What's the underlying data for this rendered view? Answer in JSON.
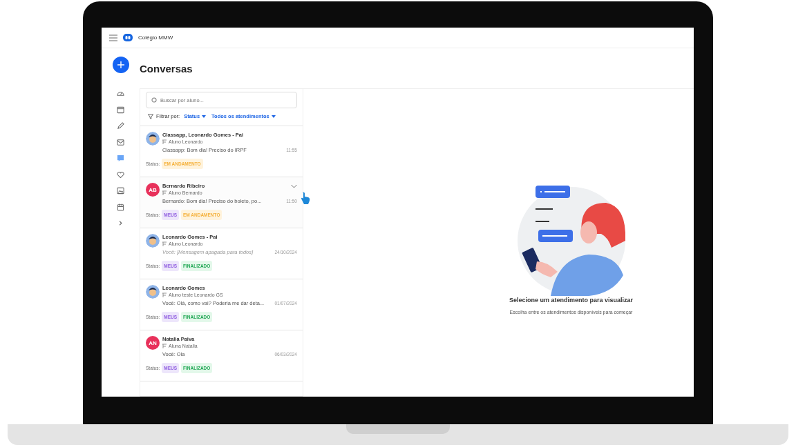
{
  "topbar": {
    "school": "Colégio MMW"
  },
  "sidebar": {
    "items": [
      {
        "kind": "dashboard",
        "selected": false
      },
      {
        "kind": "calendar",
        "selected": false
      },
      {
        "kind": "pencil",
        "selected": false
      },
      {
        "kind": "mail",
        "selected": false
      },
      {
        "kind": "chat",
        "selected": true
      },
      {
        "kind": "heart",
        "selected": false
      },
      {
        "kind": "image",
        "selected": false
      },
      {
        "kind": "agenda",
        "selected": false
      },
      {
        "kind": "chevron",
        "selected": false
      }
    ]
  },
  "page": {
    "title": "Conversas"
  },
  "search": {
    "placeholder": "Buscar por aluno..."
  },
  "filter": {
    "label": "Filtrar por:",
    "options": [
      "Status",
      "Todos os atendimentos"
    ]
  },
  "conversations": [
    {
      "avatar": {
        "kind": "cartoon"
      },
      "name": "Classapp, Leonardo Gomes - Pai",
      "student": "Aluno Leonardo",
      "message": "Classapp: Bom dia! Preciso do IRPF",
      "deleted": false,
      "time": "11:55",
      "hovered": false,
      "status_label": "Status:",
      "tags": [
        {
          "kind": "progress",
          "text": "EM ANDAMENTO"
        }
      ]
    },
    {
      "avatar": {
        "kind": "initials",
        "text": "AB",
        "color": "#e8315b"
      },
      "name": "Bernardo Ribeiro",
      "student": "Aluno Bernardo",
      "message": "Bernardo: Bom dia! Preciso do boleto, po...",
      "deleted": false,
      "time": "11:50",
      "hovered": true,
      "status_label": "Status:",
      "tags": [
        {
          "kind": "mine",
          "text": "MEUS"
        },
        {
          "kind": "progress",
          "text": "EM ANDAMENTO"
        }
      ]
    },
    {
      "avatar": {
        "kind": "cartoon"
      },
      "name": "Leonardo Gomes - Pai",
      "student": "Aluno Leonardo",
      "message": "Você: [Mensagem apagada para todos]",
      "deleted": true,
      "time": "24/10/2024",
      "hovered": false,
      "status_label": "Status:",
      "tags": [
        {
          "kind": "mine",
          "text": "MEUS"
        },
        {
          "kind": "done",
          "text": "FINALIZADO"
        }
      ]
    },
    {
      "avatar": {
        "kind": "cartoon"
      },
      "name": "Leonardo Gomes",
      "student": "Aluno teste Leonardo GS",
      "message": "Você: Olá, como vai? Poderia me dar deta...",
      "deleted": false,
      "time": "01/07/2024",
      "hovered": false,
      "status_label": "Status:",
      "tags": [
        {
          "kind": "mine",
          "text": "MEUS"
        },
        {
          "kind": "done",
          "text": "FINALIZADO"
        }
      ]
    },
    {
      "avatar": {
        "kind": "initials",
        "text": "AN",
        "color": "#e8315b"
      },
      "name": "Natalia Paiva",
      "student": "Aluna Natalia",
      "message": "Você: Ola",
      "deleted": false,
      "time": "06/03/2024",
      "hovered": false,
      "status_label": "Status:",
      "tags": [
        {
          "kind": "mine",
          "text": "MEUS"
        },
        {
          "kind": "done",
          "text": "FINALIZADO"
        }
      ]
    }
  ],
  "empty_state": {
    "title": "Selecione um atendimento para visualizar",
    "subtitle": "Escolha entre os atendimentos disponíveis para começar"
  }
}
